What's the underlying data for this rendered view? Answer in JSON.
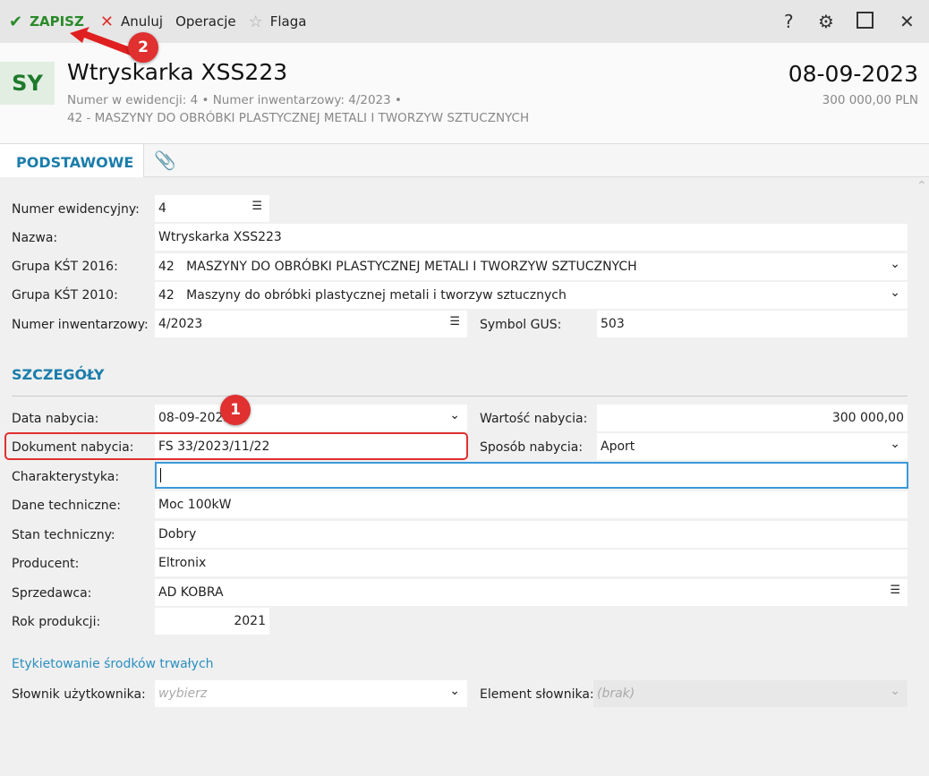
{
  "toolbar": {
    "save": "ZAPISZ",
    "cancel": "Anuluj",
    "operations": "Operacje",
    "flag": "Flaga",
    "help": "?"
  },
  "header": {
    "avatar": "SY",
    "title": "Wtryskarka XSS223",
    "sub1": "Numer w ewidencji: 4  •  Numer inwentarzowy: 4/2023  •",
    "sub2": "42 - MASZYNY DO OBRÓBKI PLASTYCZNEJ METALI I TWORZYW SZTUCZNYCH",
    "date": "08-09-2023",
    "amount": "300 000,00 PLN"
  },
  "tabs": {
    "basic": "PODSTAWOWE"
  },
  "form": {
    "numer_ew": {
      "label": "Numer ewidencyjny:",
      "value": "4"
    },
    "nazwa": {
      "label": "Nazwa:",
      "value": "Wtryskarka XSS223"
    },
    "kst2016": {
      "label": "Grupa KŚT 2016:",
      "value": "42   MASZYNY DO OBRÓBKI PLASTYCZNEJ METALI I TWORZYW SZTUCZNYCH"
    },
    "kst2010": {
      "label": "Grupa KŚT 2010:",
      "value": "42   Maszyny do obróbki plastycznej metali i tworzyw sztucznych"
    },
    "numer_inw": {
      "label": "Numer inwentarzowy:",
      "value": "4/2023"
    },
    "gus": {
      "label": "Symbol GUS:",
      "value": "503"
    }
  },
  "details": {
    "title": "SZCZEGÓŁY",
    "data": {
      "label": "Data nabycia:",
      "value": "08-09-2023"
    },
    "wartosc": {
      "label": "Wartość nabycia:",
      "value": "300 000,00"
    },
    "dokument": {
      "label": "Dokument nabycia:",
      "value": "FS 33/2023/11/22"
    },
    "sposob": {
      "label": "Sposób nabycia:",
      "value": "Aport"
    },
    "charakt": {
      "label": "Charakterystyka:",
      "value": ""
    },
    "dane": {
      "label": "Dane techniczne:",
      "value": "Moc 100kW"
    },
    "stan": {
      "label": "Stan techniczny:",
      "value": "Dobry"
    },
    "producent": {
      "label": "Producent:",
      "value": "Eltronix"
    },
    "sprzedawca": {
      "label": "Sprzedawca:",
      "value": "AD KOBRA"
    },
    "rok": {
      "label": "Rok produkcji:",
      "value": "2021"
    }
  },
  "labels": {
    "link": "Etykietowanie środków trwałych",
    "slownik": {
      "label": "Słownik użytkownika:",
      "placeholder": "wybierz"
    },
    "element": {
      "label": "Element słownika:",
      "placeholder": "(brak)"
    }
  },
  "annotations": {
    "b1": "1",
    "b2": "2"
  }
}
